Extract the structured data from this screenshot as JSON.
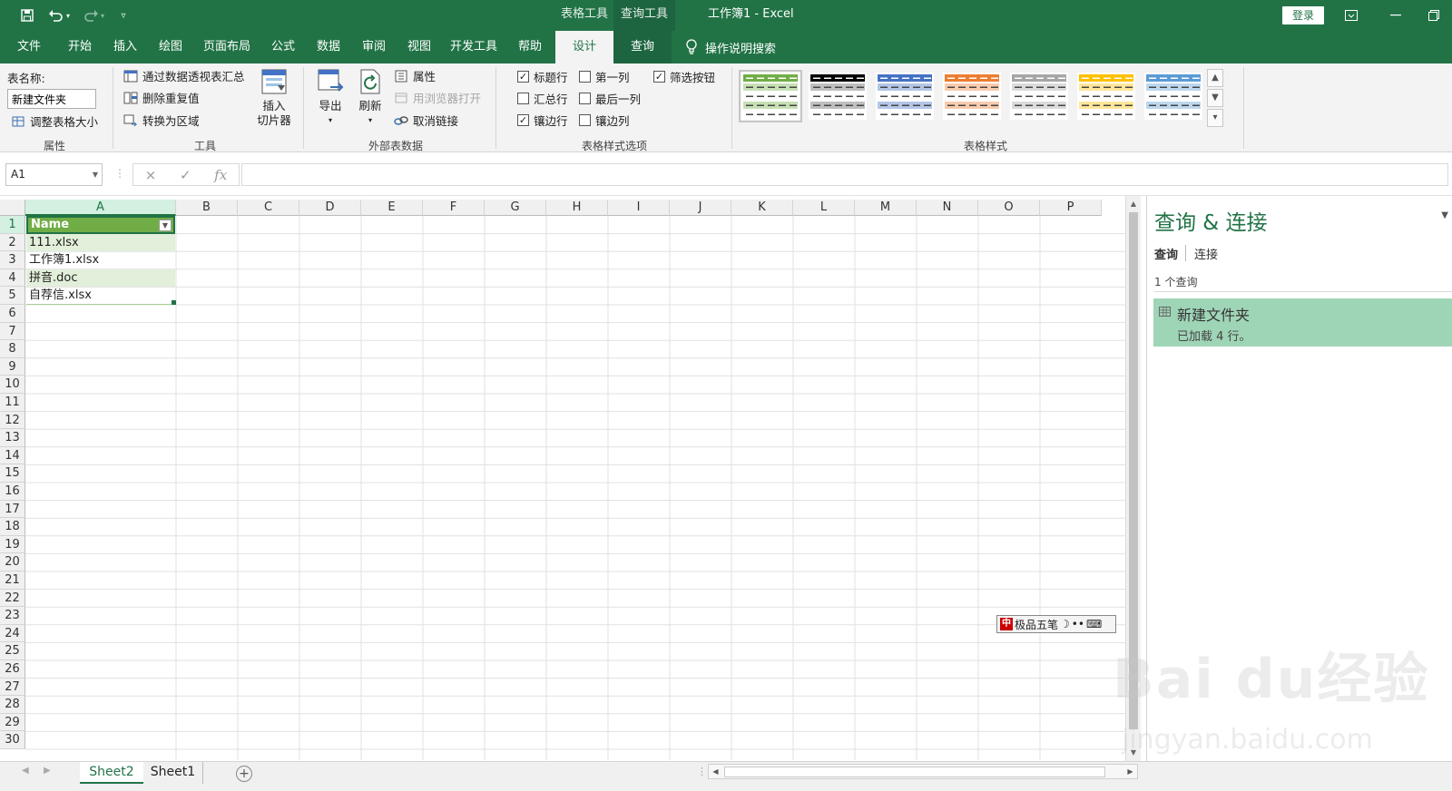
{
  "window": {
    "title": "工作簿1  -  Excel",
    "context_tab_table": "表格工具",
    "context_tab_query": "查询工具",
    "login_label": "登录"
  },
  "tabs": [
    {
      "label": "文件"
    },
    {
      "label": "开始"
    },
    {
      "label": "插入"
    },
    {
      "label": "绘图"
    },
    {
      "label": "页面布局"
    },
    {
      "label": "公式"
    },
    {
      "label": "数据"
    },
    {
      "label": "审阅"
    },
    {
      "label": "视图"
    },
    {
      "label": "开发工具"
    },
    {
      "label": "帮助"
    },
    {
      "label": "设计",
      "selected": true
    },
    {
      "label": "查询"
    }
  ],
  "tell_me": "操作说明搜索",
  "ribbon": {
    "properties": {
      "table_name_label": "表名称:",
      "table_name_value": "新建文件夹",
      "resize_label": "调整表格大小",
      "group_label": "属性"
    },
    "tools": {
      "pivot_label": "通过数据透视表汇总",
      "remove_dup_label": "删除重复值",
      "convert_label": "转换为区域",
      "slicer_line1": "插入",
      "slicer_line2": "切片器",
      "group_label": "工具"
    },
    "external": {
      "export_label": "导出",
      "refresh_label": "刷新",
      "properties_label": "属性",
      "open_browser_label": "用浏览器打开",
      "unlink_label": "取消链接",
      "group_label": "外部表数据"
    },
    "style_options": {
      "header_row": {
        "label": "标题行",
        "checked": true
      },
      "total_row": {
        "label": "汇总行",
        "checked": false
      },
      "banded_rows": {
        "label": "镶边行",
        "checked": true
      },
      "first_column": {
        "label": "第一列",
        "checked": false
      },
      "last_column": {
        "label": "最后一列",
        "checked": false
      },
      "banded_columns": {
        "label": "镶边列",
        "checked": false
      },
      "filter_button": {
        "label": "筛选按钮",
        "checked": true
      },
      "group_label": "表格样式选项"
    },
    "table_styles": {
      "group_label": "表格样式",
      "swatches": [
        {
          "head": "#70ad47",
          "band": "#c6e0b4",
          "selected": true
        },
        {
          "head": "#000000",
          "band": "#bfbfbf"
        },
        {
          "head": "#4472c4",
          "band": "#b4c6e7"
        },
        {
          "head": "#ed7d31",
          "band": "#f8cbad"
        },
        {
          "head": "#a5a5a5",
          "band": "#dbdbdb"
        },
        {
          "head": "#ffc000",
          "band": "#ffe699"
        },
        {
          "head": "#5b9bd5",
          "band": "#bdd7ee"
        }
      ]
    }
  },
  "formula_bar": {
    "name_box": "A1",
    "cancel_icon": "×",
    "enter_icon": "✓",
    "fx_label": "fx"
  },
  "grid": {
    "columns": [
      "A",
      "B",
      "C",
      "D",
      "E",
      "F",
      "G",
      "H",
      "I",
      "J",
      "K",
      "L",
      "M",
      "N",
      "O",
      "P"
    ],
    "rows": [
      "1",
      "2",
      "3",
      "4",
      "5",
      "6",
      "7",
      "8",
      "9",
      "10",
      "11",
      "12",
      "13",
      "14",
      "15",
      "16",
      "17",
      "18",
      "19",
      "20",
      "21",
      "22",
      "23",
      "24",
      "25",
      "26",
      "27",
      "28",
      "29",
      "30"
    ],
    "table_header": "Name",
    "table_rows": [
      "111.xlsx",
      "工作簿1.xlsx",
      "拼音.doc",
      "自荐信.xlsx"
    ]
  },
  "ime_bar": {
    "label": "极品五笔",
    "mode": "中"
  },
  "query_pane": {
    "title": "查询 & 连接",
    "tab_queries": "查询",
    "tab_connections": "连接",
    "count_label": "1 个查询",
    "item_name": "新建文件夹",
    "item_status": "已加载 4 行。"
  },
  "sheets": [
    {
      "label": "Sheet2",
      "active": true
    },
    {
      "label": "Sheet1",
      "active": false
    }
  ],
  "watermark": {
    "brand": "Bai du经验",
    "url": "jingyan.baidu.com"
  },
  "colors": {
    "accent": "#217346",
    "table_header": "#70ad47",
    "table_band": "#e2efda",
    "query_item": "#9fd5b7"
  }
}
